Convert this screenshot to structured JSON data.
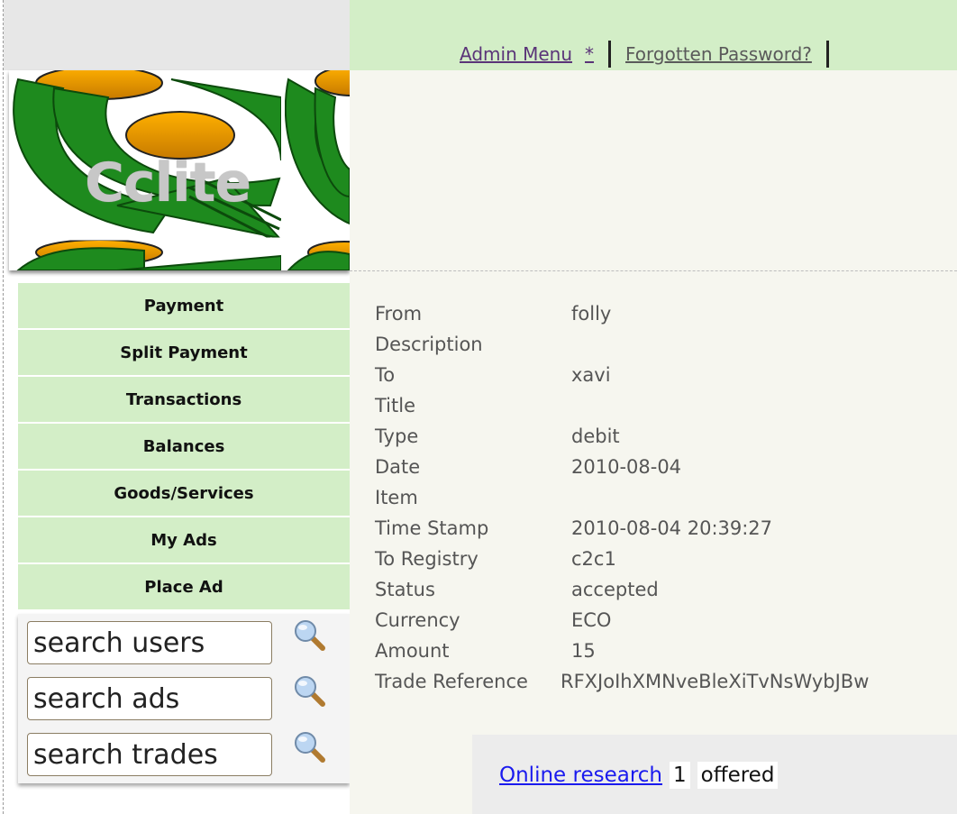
{
  "logo": {
    "text": "Cclite"
  },
  "top_nav": {
    "admin_menu": "Admin Menu",
    "asterisk": "*",
    "forgotten_password": "Forgotten Password?"
  },
  "menu": {
    "items": [
      {
        "label": "Payment"
      },
      {
        "label": "Split Payment"
      },
      {
        "label": "Transactions"
      },
      {
        "label": "Balances"
      },
      {
        "label": "Goods/Services"
      },
      {
        "label": "My Ads"
      },
      {
        "label": "Place Ad"
      }
    ]
  },
  "search": {
    "users": {
      "value": "search users",
      "icon": "magnifier-icon"
    },
    "ads": {
      "value": "search ads",
      "icon": "magnifier-icon"
    },
    "trades": {
      "value": "search trades",
      "icon": "magnifier-icon"
    }
  },
  "transaction": {
    "rows": [
      {
        "label": "From",
        "value": "folly"
      },
      {
        "label": "Description",
        "value": ""
      },
      {
        "label": "To",
        "value": "xavi"
      },
      {
        "label": "Title",
        "value": ""
      },
      {
        "label": "Type",
        "value": "debit"
      },
      {
        "label": "Date",
        "value": "2010-08-04"
      },
      {
        "label": "Item",
        "value": ""
      },
      {
        "label": "Time Stamp",
        "value": "2010-08-04 20:39:27"
      },
      {
        "label": "To Registry",
        "value": "c2c1"
      },
      {
        "label": "Status",
        "value": "accepted"
      },
      {
        "label": "Currency",
        "value": "ECO"
      },
      {
        "label": "Amount",
        "value": "15"
      },
      {
        "label": "Trade Reference",
        "value": "RFXJoIhXMNveBleXiTvNsWybJBw"
      }
    ]
  },
  "goods": {
    "link": "Online research",
    "count": "1",
    "status": "offered"
  },
  "colors": {
    "menu_bg": "#d3eec7",
    "content_bg": "#f6f6ef",
    "link_blue": "#1a1aee",
    "visited_purple": "#5a3478"
  }
}
